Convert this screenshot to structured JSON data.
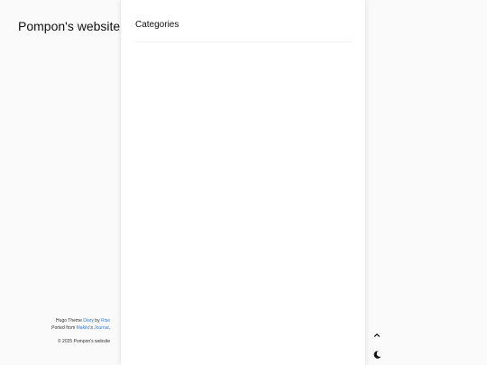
{
  "sidebar": {
    "site_title": "Pompon's website",
    "footer": {
      "line1_prefix": "Hugo Theme ",
      "theme_link": "Diary",
      "line1_by": " by ",
      "author_link": "Rise",
      "line2_prefix": "Ported from ",
      "ported_author_link": "Makito",
      "line2_mid": "'s ",
      "journal_link": "Journal",
      "line2_suffix": ".",
      "copyright": "© 2025 Pompon's website"
    }
  },
  "main": {
    "heading": "Categories"
  },
  "controls": {
    "back_to_top_icon": "chevron-up-icon",
    "dark_mode_icon": "moon-icon"
  },
  "colors": {
    "link": "#3b7bd6",
    "card_background": "#ffffff",
    "page_background": "#fafafa"
  }
}
